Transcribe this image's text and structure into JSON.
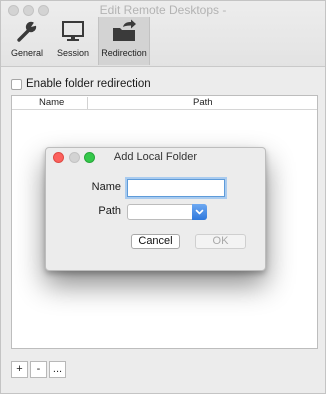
{
  "window": {
    "title": "Edit Remote Desktops -"
  },
  "toolbar": {
    "items": [
      {
        "label": "General",
        "icon": "wrench-icon",
        "selected": false
      },
      {
        "label": "Session",
        "icon": "monitor-icon",
        "selected": false
      },
      {
        "label": "Redirection",
        "icon": "folder-redirect-icon",
        "selected": true
      }
    ]
  },
  "redirection": {
    "enable_label": "Enable folder redirection",
    "enabled": false,
    "table": {
      "columns": [
        "Name",
        "Path"
      ],
      "rows": []
    },
    "buttons": {
      "add": "+",
      "remove": "-",
      "more": "..."
    }
  },
  "dialog": {
    "title": "Add Local Folder",
    "name_label": "Name",
    "name_value": "",
    "path_label": "Path",
    "path_value": "",
    "cancel_label": "Cancel",
    "ok_label": "OK"
  },
  "colors": {
    "accent": "#2f78dc",
    "close": "#fc615d",
    "zoom": "#34c84a"
  }
}
